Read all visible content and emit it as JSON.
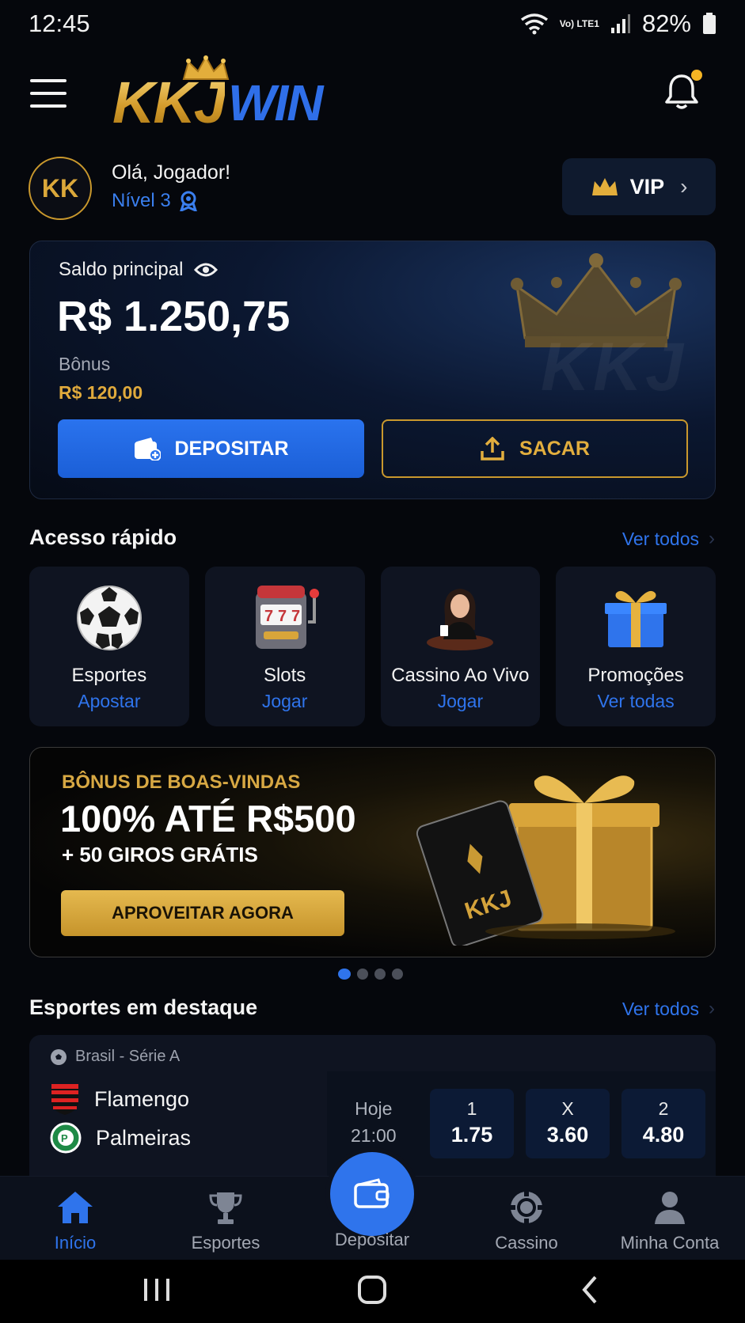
{
  "status_bar": {
    "time": "12:45",
    "network": "Vo) LTE1",
    "battery": "82%"
  },
  "header": {
    "logo_part1": "KKJ",
    "logo_part2": "WIN"
  },
  "profile": {
    "initials": "KK",
    "greeting": "Olá, Jogador!",
    "level": "Nível 3",
    "vip_label": "VIP"
  },
  "balance": {
    "label": "Saldo principal",
    "value": "R$ 1.250,75",
    "bonus_label": "Bônus",
    "bonus_value": "R$ 120,00",
    "watermark": "KKJ",
    "deposit_label": "DEPOSITAR",
    "withdraw_label": "SACAR"
  },
  "quick_access": {
    "title": "Acesso rápido",
    "see_all": "Ver todos",
    "items": [
      {
        "title": "Esportes",
        "action": "Apostar",
        "icon": "soccer-ball-icon"
      },
      {
        "title": "Slots",
        "action": "Jogar",
        "icon": "slot-machine-icon"
      },
      {
        "title": "Cassino Ao Vivo",
        "action": "Jogar",
        "icon": "live-dealer-icon"
      },
      {
        "title": "Promoções",
        "action": "Ver todas",
        "icon": "gift-icon"
      }
    ]
  },
  "promo": {
    "tag": "BÔNUS DE BOAS-VINDAS",
    "headline": "100% ATÉ R$500",
    "sub": "+ 50 GIROS GRÁTIS",
    "cta": "APROVEITAR AGORA",
    "card_text": "KKJ",
    "slides": 4,
    "active_slide": 1
  },
  "sports": {
    "title": "Esportes em destaque",
    "see_all": "Ver todos",
    "match": {
      "league": "Brasil - Série A",
      "home": "Flamengo",
      "away": "Palmeiras",
      "day": "Hoje",
      "time": "21:00",
      "odds": [
        {
          "label": "1",
          "value": "1.75"
        },
        {
          "label": "X",
          "value": "3.60"
        },
        {
          "label": "2",
          "value": "4.80"
        }
      ]
    }
  },
  "bottom_nav": {
    "items": [
      "Início",
      "Esportes",
      "Depositar",
      "Cassino",
      "Minha Conta"
    ],
    "active": "Início"
  },
  "colors": {
    "accent_blue": "#2f74ec",
    "gold": "#d9a53a",
    "background": "#05070c"
  }
}
